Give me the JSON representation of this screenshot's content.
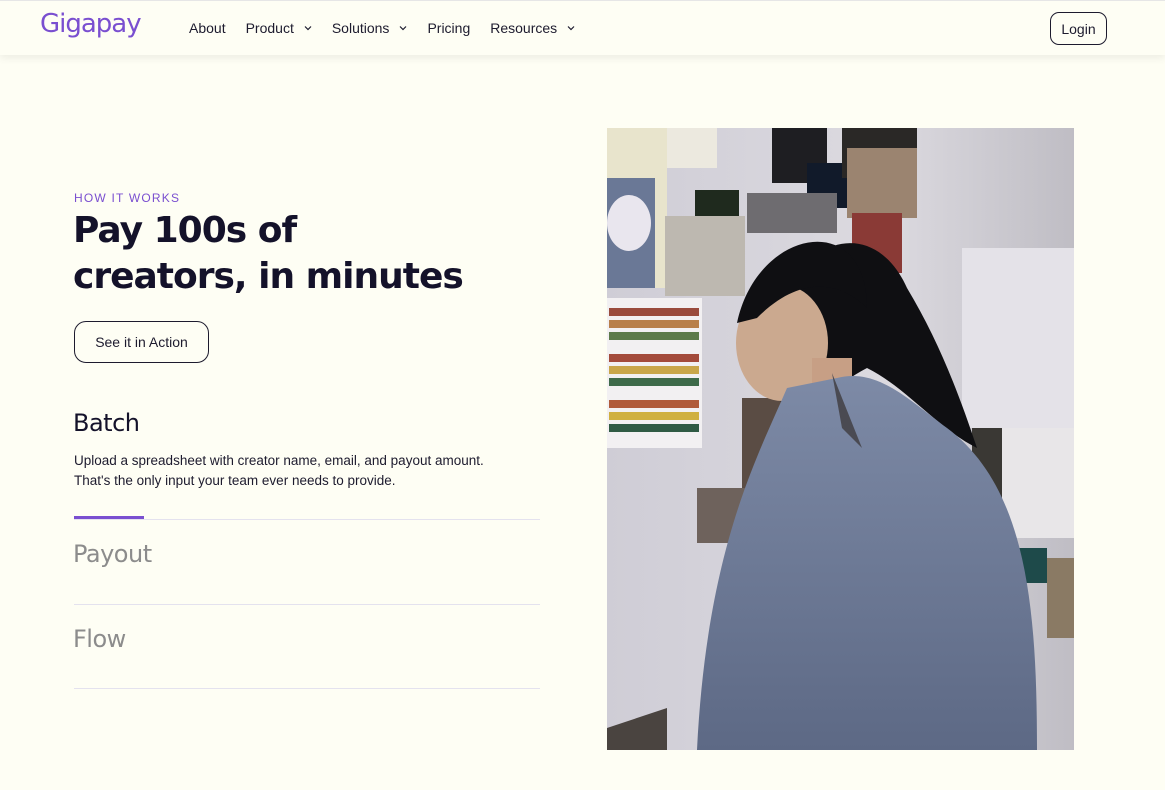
{
  "header": {
    "logo": "Gigapay",
    "nav": [
      {
        "label": "About",
        "has_dropdown": false
      },
      {
        "label": "Product",
        "has_dropdown": true
      },
      {
        "label": "Solutions",
        "has_dropdown": true
      },
      {
        "label": "Pricing",
        "has_dropdown": false
      },
      {
        "label": "Resources",
        "has_dropdown": true
      }
    ],
    "login_label": "Login"
  },
  "hero": {
    "eyebrow": "HOW IT WORKS",
    "title_line1": "Pay 100s of",
    "title_line2": "creators, in minutes",
    "cta_label": "See it in Action"
  },
  "steps": [
    {
      "title": "Batch",
      "description": "Upload a spreadsheet with creator name, email, and payout amount. That's the only input your team ever needs to provide.",
      "active": true
    },
    {
      "title": "Payout",
      "active": false
    },
    {
      "title": "Flow",
      "active": false
    }
  ],
  "colors": {
    "accent": "#7a4fd0",
    "background": "#fefef4",
    "text": "#14122a",
    "muted": "#8c8c8c"
  },
  "progress_fraction": 0.15
}
